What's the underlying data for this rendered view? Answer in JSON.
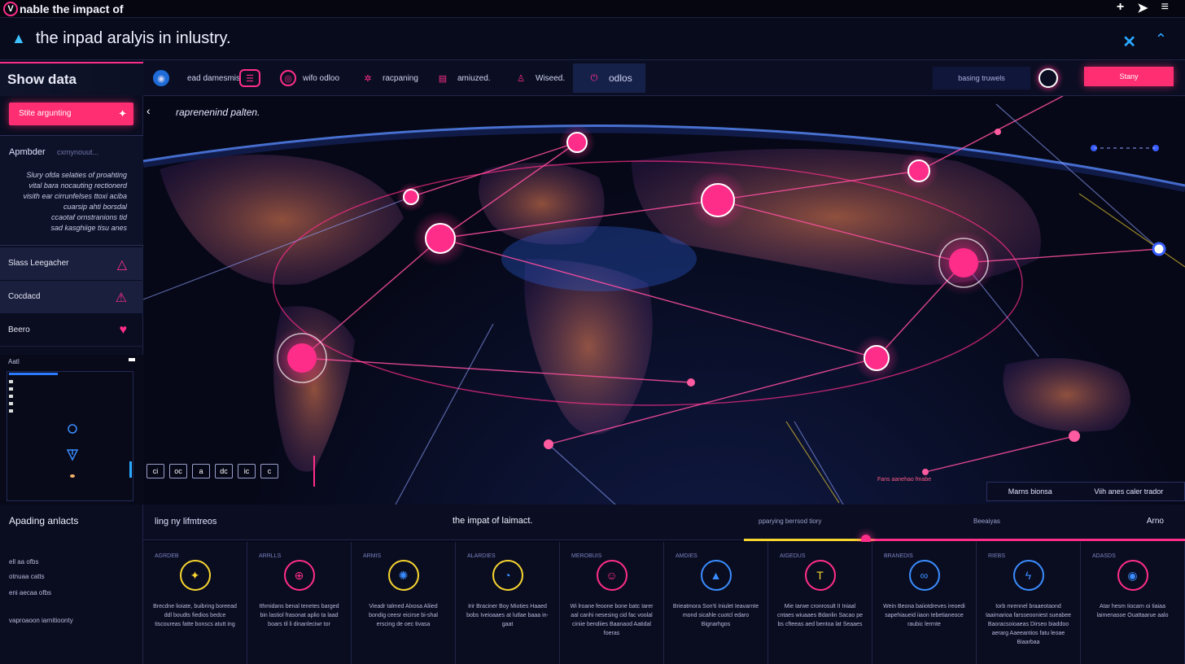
{
  "titlebar": {
    "logo_letter": "V",
    "title": "nable the impact of",
    "icons": [
      "plus-icon",
      "send-icon",
      "menu-icon"
    ]
  },
  "subhead": {
    "title": "the inpad aralyis in inlustry."
  },
  "sidebar": {
    "show_data": "Show data",
    "pink_button": "Stite argunting",
    "panel_title": "Apmbder",
    "panel_title2": "cxmynouut...",
    "panel_body": [
      "Slury ofda selaties of proahting",
      "vital bara nocauting rectionerd",
      "visith ear cirrunfelses ttoxi aciba",
      "cuarsip ahti borsdal",
      "ccaotaf ornstranions tid",
      "sad kasghiige tisu anes"
    ],
    "rows": [
      {
        "label": "Slass Leegacher",
        "icon": "triangle-icon"
      },
      {
        "label": "Cocdacd",
        "icon": "warning-icon"
      },
      {
        "label": "Beero",
        "icon": "heart-icon"
      }
    ],
    "mini_label": "Aatl"
  },
  "tabs": [
    {
      "label": "ead damesmis",
      "icon": "globe-icon",
      "color": "#3a8dff"
    },
    {
      "label": "",
      "icon": "stack-icon",
      "color": "#ff2d8a"
    },
    {
      "label": "wifo odloo",
      "icon": "ring-icon",
      "color": "#ff2d8a"
    },
    {
      "label": "racpaning",
      "icon": "share-icon",
      "color": "#ff2d8a"
    },
    {
      "label": "amiuzed.",
      "icon": "box-icon",
      "color": "#ff2d8a"
    },
    {
      "label": "Wiseed.",
      "icon": "person-icon",
      "color": "#ff2d8a"
    },
    {
      "label": "odlos",
      "icon": "power-icon",
      "color": "#ff2d8a"
    }
  ],
  "trend_button": "basing truwels",
  "cta_button": "Stany",
  "map": {
    "label": "raprenenind palten.",
    "legend_a": "Marns bionsa",
    "legend_b": "Viih anes caler trador",
    "note": "Fans aanehao fmabe",
    "tools": [
      "ci",
      "oc",
      "a",
      "dc",
      "ic",
      "c"
    ]
  },
  "bottom_left": {
    "title": "Apading anlacts",
    "lines": [
      "ell aa ofbs",
      "otnuaa catts",
      "eni aecaa ofbs",
      "vaproaoon iarnitioonty"
    ]
  },
  "bottom_header": {
    "left": "ling ny lifmtreos",
    "center": "the impat of laimact.",
    "right1": "pparying berrsod tiory",
    "right2": "Beeaiyas",
    "right3": "Arno"
  },
  "cards": [
    {
      "code": "AGRDEB",
      "icon": "star-icon",
      "color": "#f8d530",
      "text": "Brecdne lioiate, buibring boreead ddl boudts fiedios bedce tiscoureas fatte bonscs atutt ing"
    },
    {
      "code": "ARRLLS",
      "icon": "target-icon",
      "color": "#ff2d8a",
      "text": "Ithmidans benal tenetes barged bin lastiol frasonat aplio ta laad boars til li dinanleciwr tor"
    },
    {
      "code": "ARMIS",
      "icon": "gear-icon",
      "color": "#f8d530",
      "text": "Vieadr talmed Alxosa Aliied bondig ceesr eicirse bi-shal erscing de oec tivasa"
    },
    {
      "code": "ALARDIES",
      "icon": "chart-icon",
      "color": "#f8d530",
      "text": "Irir Braciner Boy Mioties Haaed bobs Iveioaaes at lutlae baaa in-gaat"
    },
    {
      "code": "MEROBUIS",
      "icon": "smile-icon",
      "color": "#ff2d8a",
      "text": "Wi lroane feoone bone batc Iarer aal canhi nesesing cid fac voolal ciniie bendiies Baanaod Aatidal foeras"
    },
    {
      "code": "AMDIES",
      "icon": "arrow-up-icon",
      "color": "#3a8dff",
      "text": "Brieatmora Son'ti Iniulet Ieavarnte mond sicahle cuotcl edaro Bignarhgos"
    },
    {
      "code": "AIGEDUS",
      "icon": "trophy-icon",
      "color": "#ff2d8a",
      "text": "Mie Iarwe cronrosult II Iniaal cntaes wiuaaes Bdanlin Sacao pe bs cfteeas aed bentoa lat Seaaes"
    },
    {
      "code": "BRANEDIS",
      "icon": "link-icon",
      "color": "#3a8dff",
      "text": "Wein Beona baiiotdreves ireoedi sapehiaueid iiaon tebetianeoce raubic lerrnte"
    },
    {
      "code": "RIEBS",
      "icon": "bolt-icon",
      "color": "#3a8dff",
      "text": "Iorb mrennel braaeotaond Iaaimarioa farsseooniest sueabee Baoracsoioaeas Dirseo biaddoo aerarg Aaeeantios fatu leoae Biaarbaa"
    },
    {
      "code": "ADASDS",
      "icon": "eye-icon",
      "color": "#ff2d8a",
      "text": "Atar hesm Iiocarn oi Iiaiaa laimenasoe Ouattaarue aalo"
    }
  ]
}
